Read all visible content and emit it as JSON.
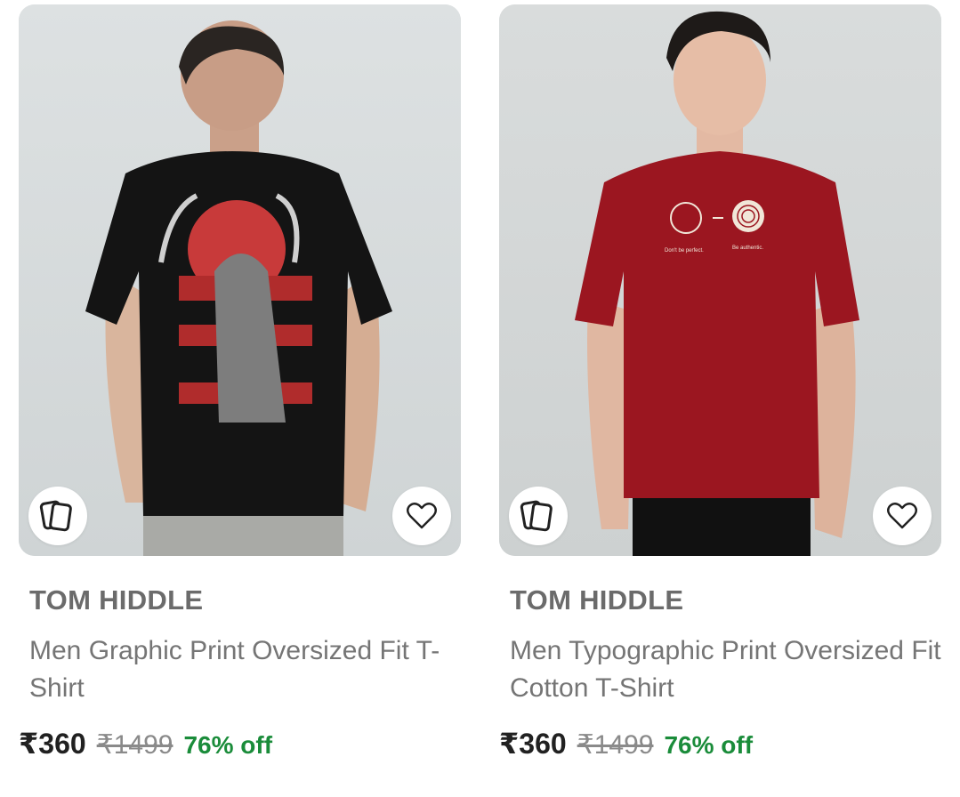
{
  "products": [
    {
      "brand": "TOM HIDDLE",
      "title": "Men Graphic Print Oversized Fit T-Shirt",
      "price": "₹360",
      "mrp": "₹1499",
      "discount": "76% off",
      "image_icon": "similar-products-icon",
      "wishlist_icon": "heart-icon",
      "tshirt_color": "#141414"
    },
    {
      "brand": "TOM HIDDLE",
      "title": "Men Typographic Print Oversized Fit Cotton T-Shirt",
      "price": "₹360",
      "mrp": "₹1499",
      "discount": "76% off",
      "print_text_left": "Don't be perfect.",
      "print_text_right": "Be authentic.",
      "image_icon": "similar-products-icon",
      "wishlist_icon": "heart-icon",
      "tshirt_color": "#9b1620"
    }
  ],
  "colors": {
    "discount_green": "#1a8c3a",
    "brand_gray": "#6b6b6b",
    "image_bg": "#d7dcdd"
  }
}
